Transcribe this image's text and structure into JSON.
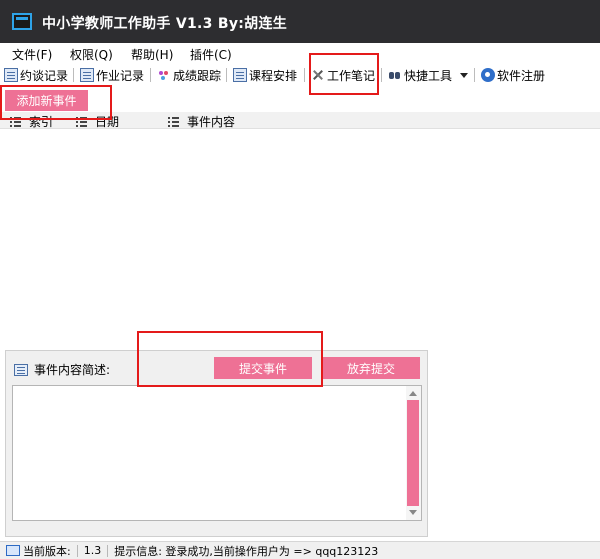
{
  "window": {
    "title": "中小学教师工作助手 V1.3  By:胡连生"
  },
  "menu": {
    "items": [
      "文件(F)",
      "权限(Q)",
      "帮助(H)",
      "插件(C)"
    ]
  },
  "toolbar": {
    "items": [
      {
        "label": "约谈记录",
        "icon": "document-icon"
      },
      {
        "label": "作业记录",
        "icon": "notebook-icon"
      },
      {
        "label": "成绩跟踪",
        "icon": "dots-icon"
      },
      {
        "label": "课程安排",
        "icon": "schedule-icon"
      },
      {
        "label": "工作笔记",
        "icon": "tools-icon"
      },
      {
        "label": "快捷工具",
        "icon": "binoculars-icon"
      },
      {
        "label": "软件注册",
        "icon": "register-icon"
      }
    ]
  },
  "add_event_label": "添加新事件",
  "columns": [
    "索引",
    "日期",
    "事件内容"
  ],
  "panel": {
    "label": "事件内容简述:",
    "submit_label": "提交事件",
    "abandon_label": "放弃提交"
  },
  "status": {
    "version_label": "当前版本:",
    "version_value": "1.3",
    "info": "提示信息: 登录成功,当前操作用户为 => qqq123123"
  },
  "colors": {
    "titlebar": "#2d2d30",
    "accent_pink": "#ee7195",
    "highlight_red": "#e41a1a"
  }
}
